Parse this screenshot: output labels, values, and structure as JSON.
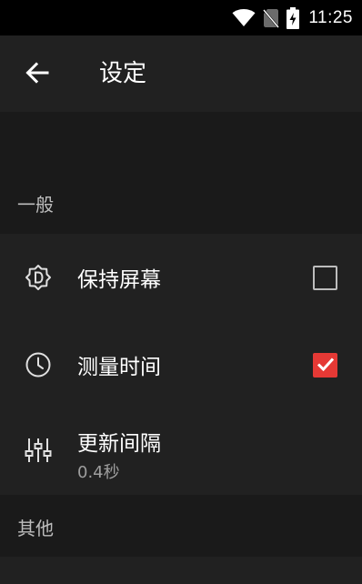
{
  "status_bar": {
    "time": "11:25",
    "icons": [
      "wifi-icon",
      "no-sim-icon",
      "battery-charging-icon"
    ]
  },
  "app_bar": {
    "back_icon": "arrow-back-icon",
    "title": "设定"
  },
  "sections": [
    {
      "header": "一般",
      "items": [
        {
          "icon": "display-brightness-icon",
          "title": "保持屏幕",
          "checked": false
        },
        {
          "icon": "clock-icon",
          "title": "测量时间",
          "checked": true
        },
        {
          "icon": "sliders-icon",
          "title": "更新间隔",
          "summary": "0.4秒"
        }
      ]
    },
    {
      "header": "其他",
      "items": []
    }
  ],
  "colors": {
    "accent": "#e53935",
    "background": "#1a1a1a",
    "surface": "#212121",
    "status_bar": "#000000"
  }
}
